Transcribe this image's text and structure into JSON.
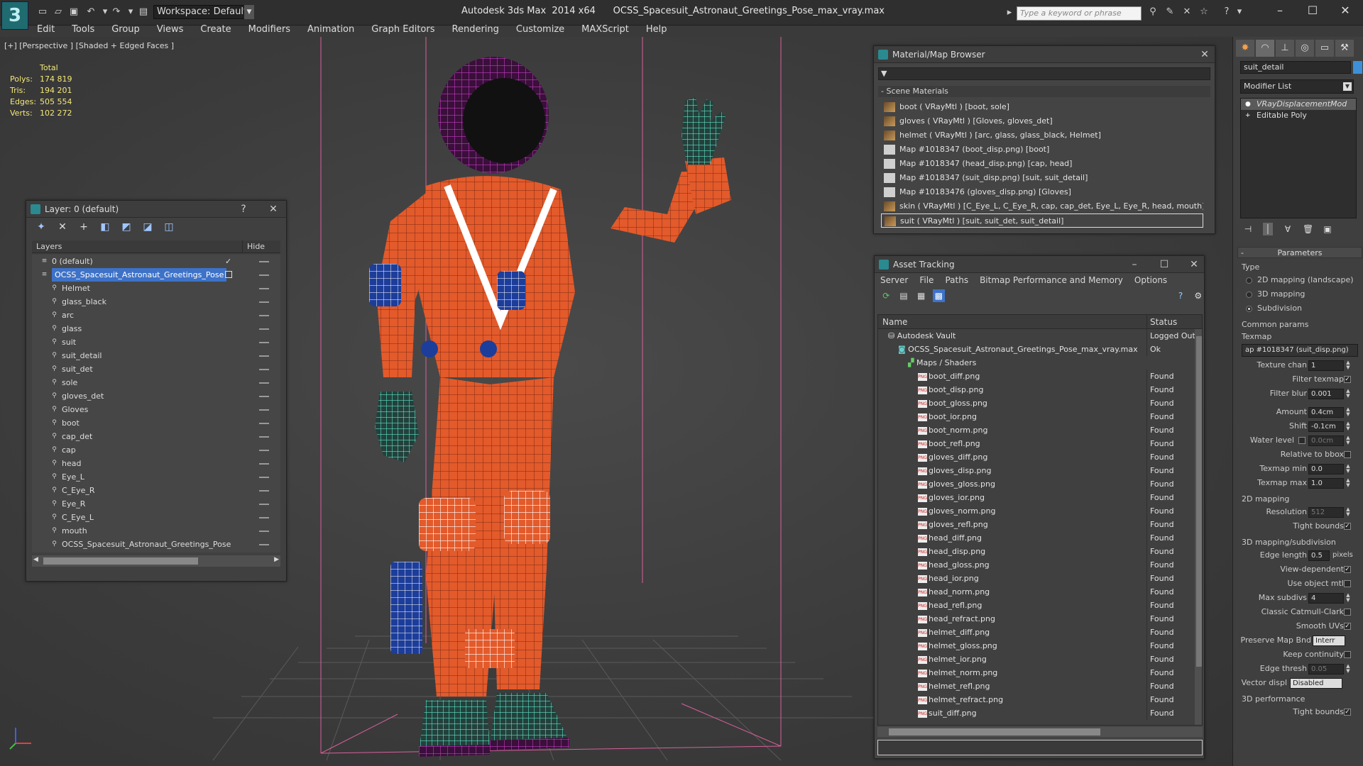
{
  "titlebar": {
    "app_letter": "3",
    "workspace": "Workspace: Default",
    "title": "Autodesk 3ds Max  2014 x64      OCSS_Spacesuit_Astronaut_Greetings_Pose_max_vray.max",
    "search_placeholder": "Type a keyword or phrase"
  },
  "menu": [
    "Edit",
    "Tools",
    "Group",
    "Views",
    "Create",
    "Modifiers",
    "Animation",
    "Graph Editors",
    "Rendering",
    "Customize",
    "MAXScript",
    "Help"
  ],
  "viewport": {
    "label": "[+] [Perspective ] [Shaded + Edged Faces ]",
    "stats": {
      "header": "Total",
      "rows": [
        {
          "k": "Polys:",
          "v": "174 819"
        },
        {
          "k": "Tris:",
          "v": "194 201"
        },
        {
          "k": "Edges:",
          "v": "505 554"
        },
        {
          "k": "Verts:",
          "v": "102 272"
        }
      ]
    }
  },
  "layer_window": {
    "title": "Layer: 0 (default)",
    "help": "?",
    "close": "✕",
    "col_layers": "Layers",
    "col_hide": "Hide",
    "layers": [
      {
        "name": "0 (default)",
        "level": 0,
        "checked": true
      },
      {
        "name": "OCSS_Spacesuit_Astronaut_Greetings_Pose",
        "level": 0,
        "selected": true
      },
      {
        "name": "Helmet",
        "level": 1
      },
      {
        "name": "glass_black",
        "level": 1
      },
      {
        "name": "arc",
        "level": 1
      },
      {
        "name": "glass",
        "level": 1
      },
      {
        "name": "suit",
        "level": 1
      },
      {
        "name": "suit_detail",
        "level": 1
      },
      {
        "name": "suit_det",
        "level": 1
      },
      {
        "name": "sole",
        "level": 1
      },
      {
        "name": "gloves_det",
        "level": 1
      },
      {
        "name": "Gloves",
        "level": 1
      },
      {
        "name": "boot",
        "level": 1
      },
      {
        "name": "cap_det",
        "level": 1
      },
      {
        "name": "cap",
        "level": 1
      },
      {
        "name": "head",
        "level": 1
      },
      {
        "name": "Eye_L",
        "level": 1
      },
      {
        "name": "C_Eye_R",
        "level": 1
      },
      {
        "name": "Eye_R",
        "level": 1
      },
      {
        "name": "C_Eye_L",
        "level": 1
      },
      {
        "name": "mouth",
        "level": 1
      },
      {
        "name": "OCSS_Spacesuit_Astronaut_Greetings_Pose",
        "level": 1
      }
    ]
  },
  "material_browser": {
    "title": "Material/Map Browser",
    "close": "✕",
    "section": "- Scene Materials",
    "items": [
      {
        "label": "boot  ( VRayMtl ) [boot, sole]",
        "kind": "mtl"
      },
      {
        "label": "gloves  ( VRayMtl ) [Gloves, gloves_det]",
        "kind": "mtl"
      },
      {
        "label": "helmet  ( VRayMtl ) [arc, glass, glass_black, Helmet]",
        "kind": "mtl"
      },
      {
        "label": "Map #1018347 (boot_disp.png)  [boot]",
        "kind": "map"
      },
      {
        "label": "Map #1018347 (head_disp.png)  [cap, head]",
        "kind": "map"
      },
      {
        "label": "Map #1018347 (suit_disp.png)  [suit, suit_detail]",
        "kind": "map"
      },
      {
        "label": "Map #10183476 (gloves_disp.png)  [Gloves]",
        "kind": "map"
      },
      {
        "label": "skin  ( VRayMtl ) [C_Eye_L, C_Eye_R, cap, cap_det, Eye_L, Eye_R, head, mouth]",
        "kind": "mtl"
      },
      {
        "label": "suit  ( VRayMtl ) [suit, suit_det, suit_detail]",
        "kind": "mtl",
        "selected": true
      }
    ]
  },
  "asset_tracking": {
    "title": "Asset Tracking",
    "menu": [
      "Server",
      "File",
      "Paths",
      "Bitmap Performance and Memory",
      "Options"
    ],
    "col_name": "Name",
    "col_status": "Status",
    "rows": [
      {
        "name": "Autodesk Vault",
        "status": "Logged Out",
        "indent": 1,
        "kind": "vault"
      },
      {
        "name": "OCSS_Spacesuit_Astronaut_Greetings_Pose_max_vray.max",
        "status": "Ok",
        "indent": 2,
        "kind": "max"
      },
      {
        "name": "Maps / Shaders",
        "status": "",
        "indent": 3,
        "kind": "folder"
      },
      {
        "name": "boot_diff.png",
        "status": "Found",
        "indent": 4,
        "kind": "png"
      },
      {
        "name": "boot_disp.png",
        "status": "Found",
        "indent": 4,
        "kind": "png"
      },
      {
        "name": "boot_gloss.png",
        "status": "Found",
        "indent": 4,
        "kind": "png"
      },
      {
        "name": "boot_ior.png",
        "status": "Found",
        "indent": 4,
        "kind": "png"
      },
      {
        "name": "boot_norm.png",
        "status": "Found",
        "indent": 4,
        "kind": "png"
      },
      {
        "name": "boot_refl.png",
        "status": "Found",
        "indent": 4,
        "kind": "png"
      },
      {
        "name": "gloves_diff.png",
        "status": "Found",
        "indent": 4,
        "kind": "png"
      },
      {
        "name": "gloves_disp.png",
        "status": "Found",
        "indent": 4,
        "kind": "png"
      },
      {
        "name": "gloves_gloss.png",
        "status": "Found",
        "indent": 4,
        "kind": "png"
      },
      {
        "name": "gloves_ior.png",
        "status": "Found",
        "indent": 4,
        "kind": "png"
      },
      {
        "name": "gloves_norm.png",
        "status": "Found",
        "indent": 4,
        "kind": "png"
      },
      {
        "name": "gloves_refl.png",
        "status": "Found",
        "indent": 4,
        "kind": "png"
      },
      {
        "name": "head_diff.png",
        "status": "Found",
        "indent": 4,
        "kind": "png"
      },
      {
        "name": "head_disp.png",
        "status": "Found",
        "indent": 4,
        "kind": "png"
      },
      {
        "name": "head_gloss.png",
        "status": "Found",
        "indent": 4,
        "kind": "png"
      },
      {
        "name": "head_ior.png",
        "status": "Found",
        "indent": 4,
        "kind": "png"
      },
      {
        "name": "head_norm.png",
        "status": "Found",
        "indent": 4,
        "kind": "png"
      },
      {
        "name": "head_refl.png",
        "status": "Found",
        "indent": 4,
        "kind": "png"
      },
      {
        "name": "head_refract.png",
        "status": "Found",
        "indent": 4,
        "kind": "png"
      },
      {
        "name": "helmet_diff.png",
        "status": "Found",
        "indent": 4,
        "kind": "png"
      },
      {
        "name": "helmet_gloss.png",
        "status": "Found",
        "indent": 4,
        "kind": "png"
      },
      {
        "name": "helmet_ior.png",
        "status": "Found",
        "indent": 4,
        "kind": "png"
      },
      {
        "name": "helmet_norm.png",
        "status": "Found",
        "indent": 4,
        "kind": "png"
      },
      {
        "name": "helmet_refl.png",
        "status": "Found",
        "indent": 4,
        "kind": "png"
      },
      {
        "name": "helmet_refract.png",
        "status": "Found",
        "indent": 4,
        "kind": "png"
      },
      {
        "name": "suit_diff.png",
        "status": "Found",
        "indent": 4,
        "kind": "png"
      }
    ]
  },
  "command_panel": {
    "object_name": "suit_detail",
    "object_color": "#3d8fd8",
    "modifier_list": "Modifier List",
    "stack": [
      {
        "label": "VRayDisplacementMod",
        "selected": true
      },
      {
        "label": "Editable Poly",
        "selected": false
      }
    ],
    "parameters_title": "Parameters",
    "type_label": "Type",
    "type_options": [
      {
        "label": "2D mapping (landscape)",
        "on": false
      },
      {
        "label": "3D mapping",
        "on": false
      },
      {
        "label": "Subdivision",
        "on": true
      }
    ],
    "common_label": "Common params",
    "texmap_label": "Texmap",
    "texmap_value": "ap #1018347 (suit_disp.png)",
    "texture_chan_label": "Texture chan",
    "texture_chan": "1",
    "filter_texmap_label": "Filter texmap",
    "filter_blur_label": "Filter blur",
    "filter_blur": "0.001",
    "amount_label": "Amount",
    "amount": "0.4cm",
    "shift_label": "Shift",
    "shift": "-0.1cm",
    "water_level_label": "Water level",
    "water_level": "0.0cm",
    "relative_bbox_label": "Relative to bbox",
    "texmap_min_label": "Texmap min",
    "texmap_min": "0.0",
    "texmap_max_label": "Texmap max",
    "texmap_max": "1.0",
    "mapping2d_label": "2D mapping",
    "resolution_label": "Resolution",
    "resolution": "512",
    "tight_bounds_label": "Tight bounds",
    "mapping3d_label": "3D mapping/subdivision",
    "edge_length_label": "Edge length",
    "edge_length": "0.5",
    "pixels_label": "pixels",
    "view_dependent_label": "View-dependent",
    "use_object_mtl_label": "Use object mtl",
    "max_subdivs_label": "Max subdivs",
    "max_subdivs": "4",
    "classic_cc_label": "Classic Catmull-Clark",
    "smooth_uvs_label": "Smooth UVs",
    "preserve_map_label": "Preserve Map Bnd",
    "preserve_map": "Interr",
    "keep_continuity_label": "Keep continuity",
    "edge_thresh_label": "Edge thresh",
    "edge_thresh": "0.05",
    "vector_displ_label": "Vector displ",
    "vector_displ": "Disabled",
    "perf_label": "3D performance",
    "tight_bounds2_label": "Tight bounds"
  }
}
